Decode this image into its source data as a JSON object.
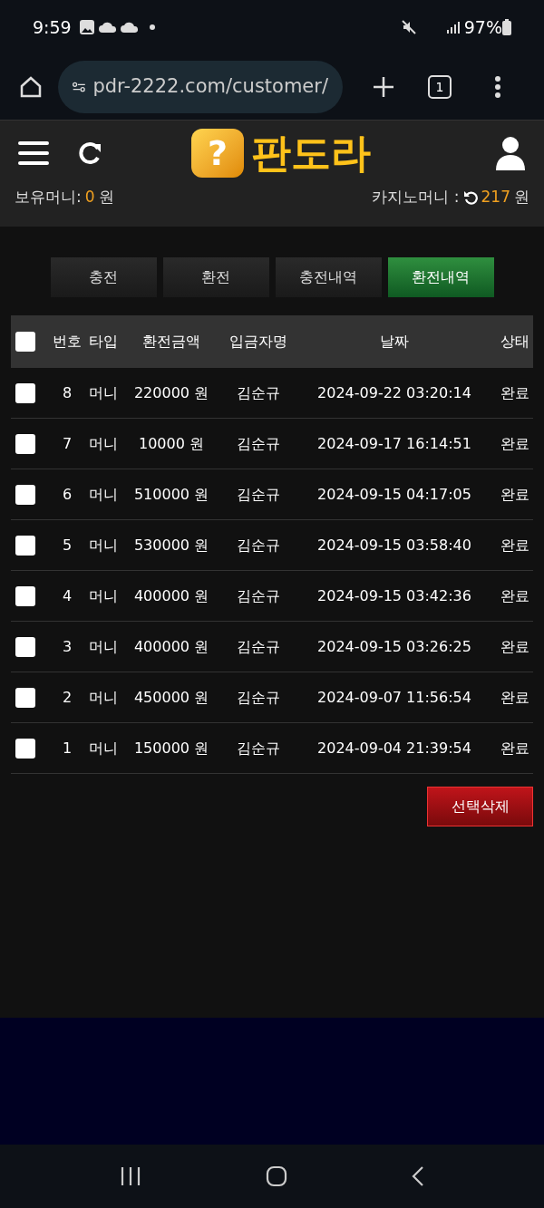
{
  "status_bar": {
    "time": "9:59",
    "battery": "97%"
  },
  "browser": {
    "url": "pdr-2222.com/customer/",
    "tab_count": "1"
  },
  "header": {
    "logo_mark": "?",
    "logo_text": "판도라"
  },
  "balances": {
    "own_label": "보유머니:",
    "own_value": "0",
    "own_unit": "원",
    "casino_label": "카지노머니 :",
    "casino_value": "217",
    "casino_unit": "원"
  },
  "tabs": [
    {
      "label": "충전",
      "selected": false
    },
    {
      "label": "환전",
      "selected": false
    },
    {
      "label": "충전내역",
      "selected": false
    },
    {
      "label": "환전내역",
      "selected": true
    }
  ],
  "table": {
    "select_all_checked": false,
    "columns": [
      "번호",
      "타입",
      "환전금액",
      "입금자명",
      "날짜",
      "상태"
    ],
    "rows": [
      {
        "checked": false,
        "cells": [
          "8",
          "머니",
          "220000 원",
          "김순규",
          "2024-09-22 03:20:14",
          "완료"
        ]
      },
      {
        "checked": false,
        "cells": [
          "7",
          "머니",
          "10000 원",
          "김순규",
          "2024-09-17 16:14:51",
          "완료"
        ]
      },
      {
        "checked": false,
        "cells": [
          "6",
          "머니",
          "510000 원",
          "김순규",
          "2024-09-15 04:17:05",
          "완료"
        ]
      },
      {
        "checked": false,
        "cells": [
          "5",
          "머니",
          "530000 원",
          "김순규",
          "2024-09-15 03:58:40",
          "완료"
        ]
      },
      {
        "checked": false,
        "cells": [
          "4",
          "머니",
          "400000 원",
          "김순규",
          "2024-09-15 03:42:36",
          "완료"
        ]
      },
      {
        "checked": false,
        "cells": [
          "3",
          "머니",
          "400000 원",
          "김순규",
          "2024-09-15 03:26:25",
          "완료"
        ]
      },
      {
        "checked": false,
        "cells": [
          "2",
          "머니",
          "450000 원",
          "김순규",
          "2024-09-07 11:56:54",
          "완료"
        ]
      },
      {
        "checked": false,
        "cells": [
          "1",
          "머니",
          "150000 원",
          "김순규",
          "2024-09-04 21:39:54",
          "완료"
        ]
      }
    ]
  },
  "delete_button": "선택삭제"
}
